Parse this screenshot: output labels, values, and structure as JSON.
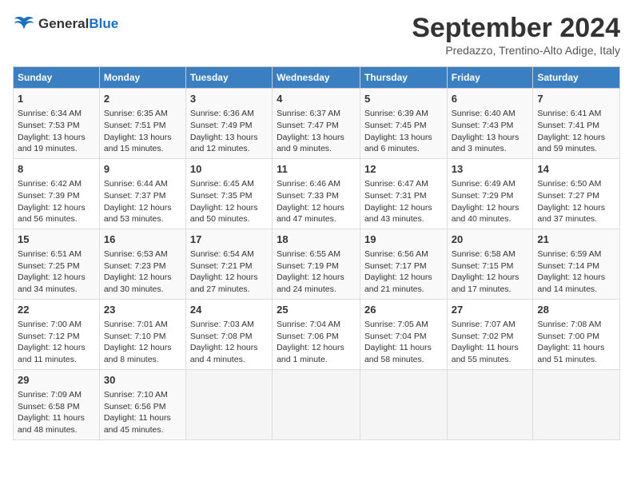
{
  "header": {
    "logo_line1": "General",
    "logo_line2": "Blue",
    "title": "September 2024",
    "location": "Predazzo, Trentino-Alto Adige, Italy"
  },
  "days_of_week": [
    "Sunday",
    "Monday",
    "Tuesday",
    "Wednesday",
    "Thursday",
    "Friday",
    "Saturday"
  ],
  "weeks": [
    [
      {
        "day": 1,
        "sunrise": "6:34 AM",
        "sunset": "7:53 PM",
        "daylight": "13 hours and 19 minutes."
      },
      {
        "day": 2,
        "sunrise": "6:35 AM",
        "sunset": "7:51 PM",
        "daylight": "13 hours and 15 minutes."
      },
      {
        "day": 3,
        "sunrise": "6:36 AM",
        "sunset": "7:49 PM",
        "daylight": "13 hours and 12 minutes."
      },
      {
        "day": 4,
        "sunrise": "6:37 AM",
        "sunset": "7:47 PM",
        "daylight": "13 hours and 9 minutes."
      },
      {
        "day": 5,
        "sunrise": "6:39 AM",
        "sunset": "7:45 PM",
        "daylight": "13 hours and 6 minutes."
      },
      {
        "day": 6,
        "sunrise": "6:40 AM",
        "sunset": "7:43 PM",
        "daylight": "13 hours and 3 minutes."
      },
      {
        "day": 7,
        "sunrise": "6:41 AM",
        "sunset": "7:41 PM",
        "daylight": "12 hours and 59 minutes."
      }
    ],
    [
      {
        "day": 8,
        "sunrise": "6:42 AM",
        "sunset": "7:39 PM",
        "daylight": "12 hours and 56 minutes."
      },
      {
        "day": 9,
        "sunrise": "6:44 AM",
        "sunset": "7:37 PM",
        "daylight": "12 hours and 53 minutes."
      },
      {
        "day": 10,
        "sunrise": "6:45 AM",
        "sunset": "7:35 PM",
        "daylight": "12 hours and 50 minutes."
      },
      {
        "day": 11,
        "sunrise": "6:46 AM",
        "sunset": "7:33 PM",
        "daylight": "12 hours and 47 minutes."
      },
      {
        "day": 12,
        "sunrise": "6:47 AM",
        "sunset": "7:31 PM",
        "daylight": "12 hours and 43 minutes."
      },
      {
        "day": 13,
        "sunrise": "6:49 AM",
        "sunset": "7:29 PM",
        "daylight": "12 hours and 40 minutes."
      },
      {
        "day": 14,
        "sunrise": "6:50 AM",
        "sunset": "7:27 PM",
        "daylight": "12 hours and 37 minutes."
      }
    ],
    [
      {
        "day": 15,
        "sunrise": "6:51 AM",
        "sunset": "7:25 PM",
        "daylight": "12 hours and 34 minutes."
      },
      {
        "day": 16,
        "sunrise": "6:53 AM",
        "sunset": "7:23 PM",
        "daylight": "12 hours and 30 minutes."
      },
      {
        "day": 17,
        "sunrise": "6:54 AM",
        "sunset": "7:21 PM",
        "daylight": "12 hours and 27 minutes."
      },
      {
        "day": 18,
        "sunrise": "6:55 AM",
        "sunset": "7:19 PM",
        "daylight": "12 hours and 24 minutes."
      },
      {
        "day": 19,
        "sunrise": "6:56 AM",
        "sunset": "7:17 PM",
        "daylight": "12 hours and 21 minutes."
      },
      {
        "day": 20,
        "sunrise": "6:58 AM",
        "sunset": "7:15 PM",
        "daylight": "12 hours and 17 minutes."
      },
      {
        "day": 21,
        "sunrise": "6:59 AM",
        "sunset": "7:14 PM",
        "daylight": "12 hours and 14 minutes."
      }
    ],
    [
      {
        "day": 22,
        "sunrise": "7:00 AM",
        "sunset": "7:12 PM",
        "daylight": "12 hours and 11 minutes."
      },
      {
        "day": 23,
        "sunrise": "7:01 AM",
        "sunset": "7:10 PM",
        "daylight": "12 hours and 8 minutes."
      },
      {
        "day": 24,
        "sunrise": "7:03 AM",
        "sunset": "7:08 PM",
        "daylight": "12 hours and 4 minutes."
      },
      {
        "day": 25,
        "sunrise": "7:04 AM",
        "sunset": "7:06 PM",
        "daylight": "12 hours and 1 minute."
      },
      {
        "day": 26,
        "sunrise": "7:05 AM",
        "sunset": "7:04 PM",
        "daylight": "11 hours and 58 minutes."
      },
      {
        "day": 27,
        "sunrise": "7:07 AM",
        "sunset": "7:02 PM",
        "daylight": "11 hours and 55 minutes."
      },
      {
        "day": 28,
        "sunrise": "7:08 AM",
        "sunset": "7:00 PM",
        "daylight": "11 hours and 51 minutes."
      }
    ],
    [
      {
        "day": 29,
        "sunrise": "7:09 AM",
        "sunset": "6:58 PM",
        "daylight": "11 hours and 48 minutes."
      },
      {
        "day": 30,
        "sunrise": "7:10 AM",
        "sunset": "6:56 PM",
        "daylight": "11 hours and 45 minutes."
      },
      null,
      null,
      null,
      null,
      null
    ]
  ]
}
